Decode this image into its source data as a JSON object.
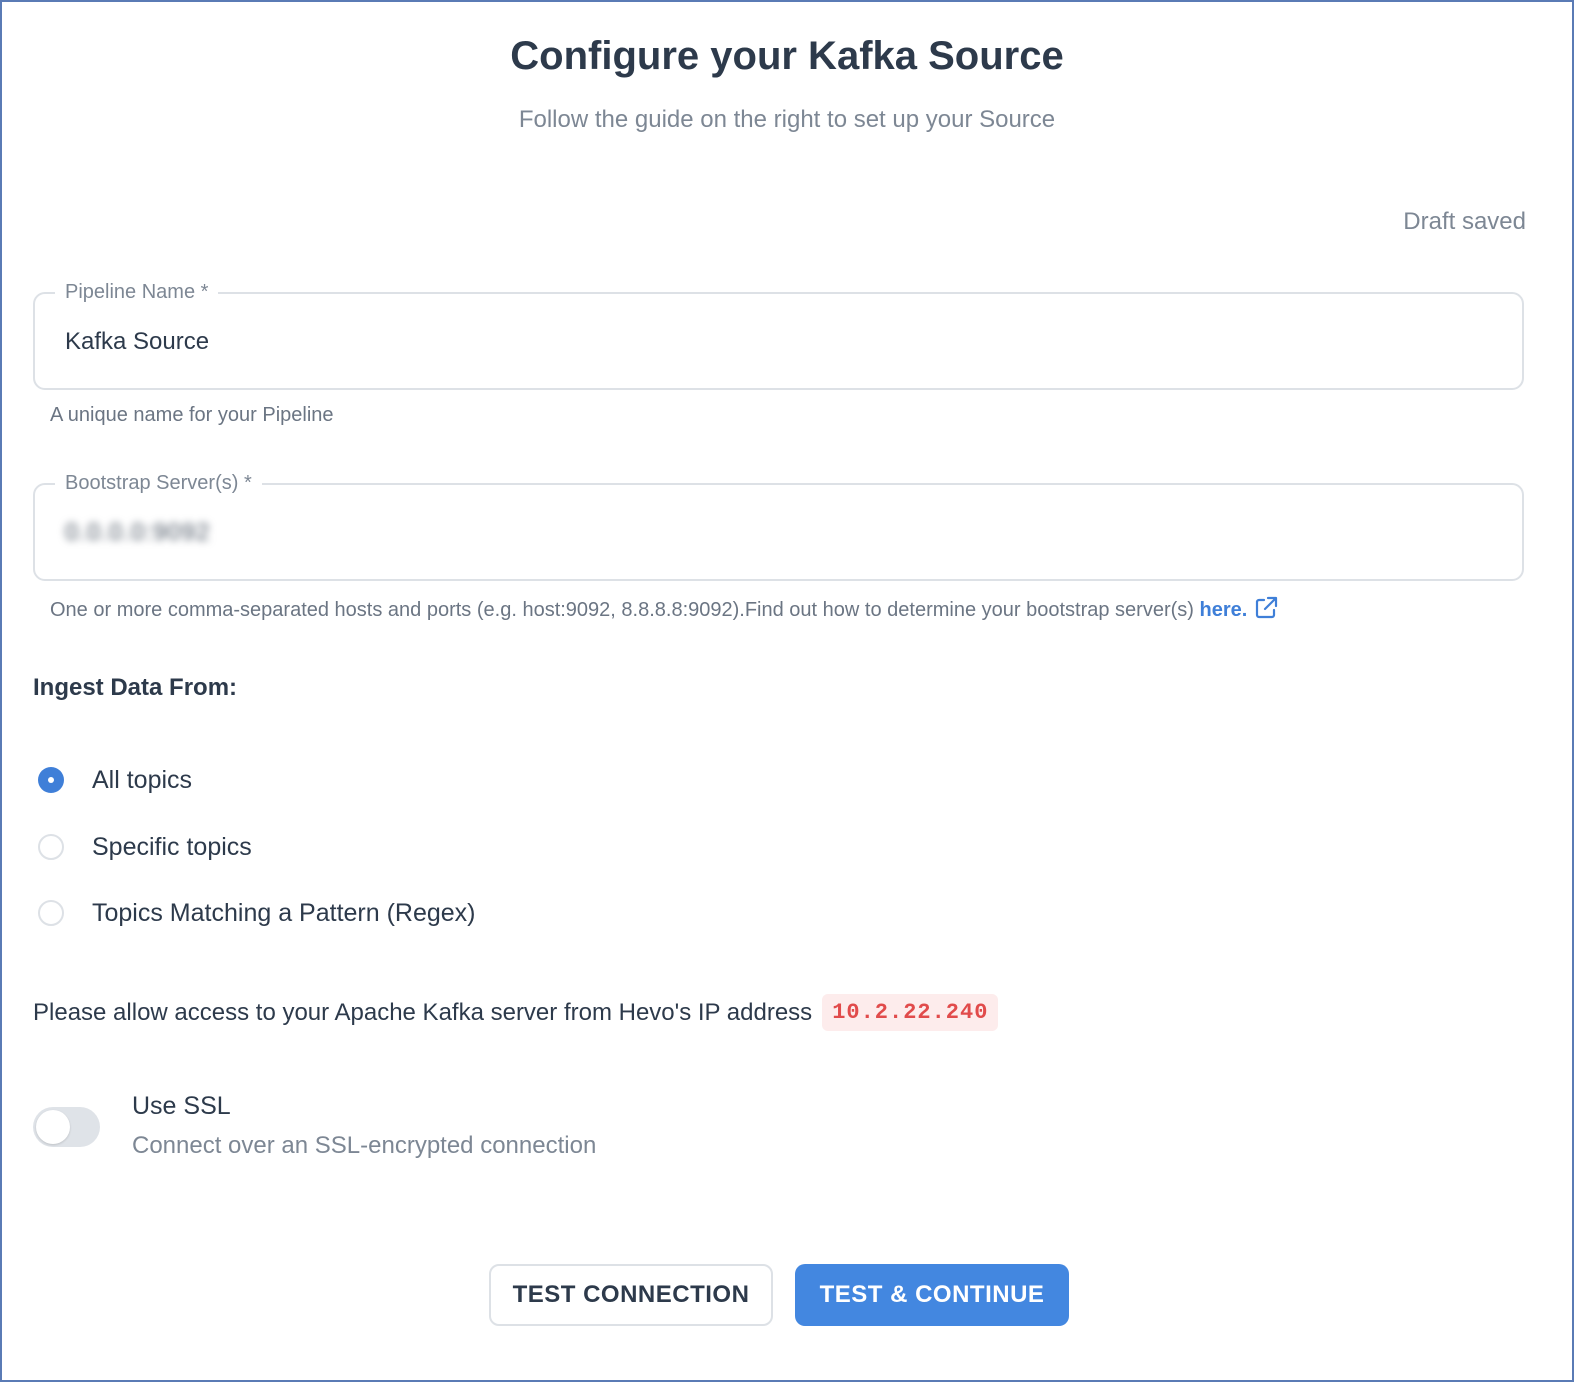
{
  "header": {
    "title": "Configure your Kafka Source",
    "subtitle": "Follow the guide on the right to set up your Source"
  },
  "status": {
    "draft": "Draft saved"
  },
  "fields": {
    "pipeline_name": {
      "label": "Pipeline Name *",
      "value": "Kafka Source",
      "helper": "A unique name for your Pipeline"
    },
    "bootstrap_servers": {
      "label": "Bootstrap Server(s) *",
      "value": "0.0.0.0:9092",
      "helper": "One or more comma-separated hosts and ports (e.g. host:9092, 8.8.8.8:9092).Find out how to determine your bootstrap server(s) ",
      "link_text": "here."
    }
  },
  "ingest": {
    "heading": "Ingest Data From:",
    "options": [
      {
        "label": "All topics",
        "checked": true
      },
      {
        "label": "Specific topics",
        "checked": false
      },
      {
        "label": "Topics Matching a Pattern (Regex)",
        "checked": false
      }
    ]
  },
  "ip_access": {
    "text": "Please allow access to your Apache Kafka server from Hevo's IP address",
    "ip": "10.2.22.240"
  },
  "ssl": {
    "title": "Use SSL",
    "description": "Connect over an SSL-encrypted connection",
    "enabled": false
  },
  "actions": {
    "test_connection": "TEST CONNECTION",
    "test_continue": "TEST & CONTINUE"
  },
  "colors": {
    "accent": "#4387e0",
    "ip_text": "#e14b4b",
    "ip_bg": "#fdecec"
  },
  "icons": {
    "external_link": "external-link-icon"
  }
}
